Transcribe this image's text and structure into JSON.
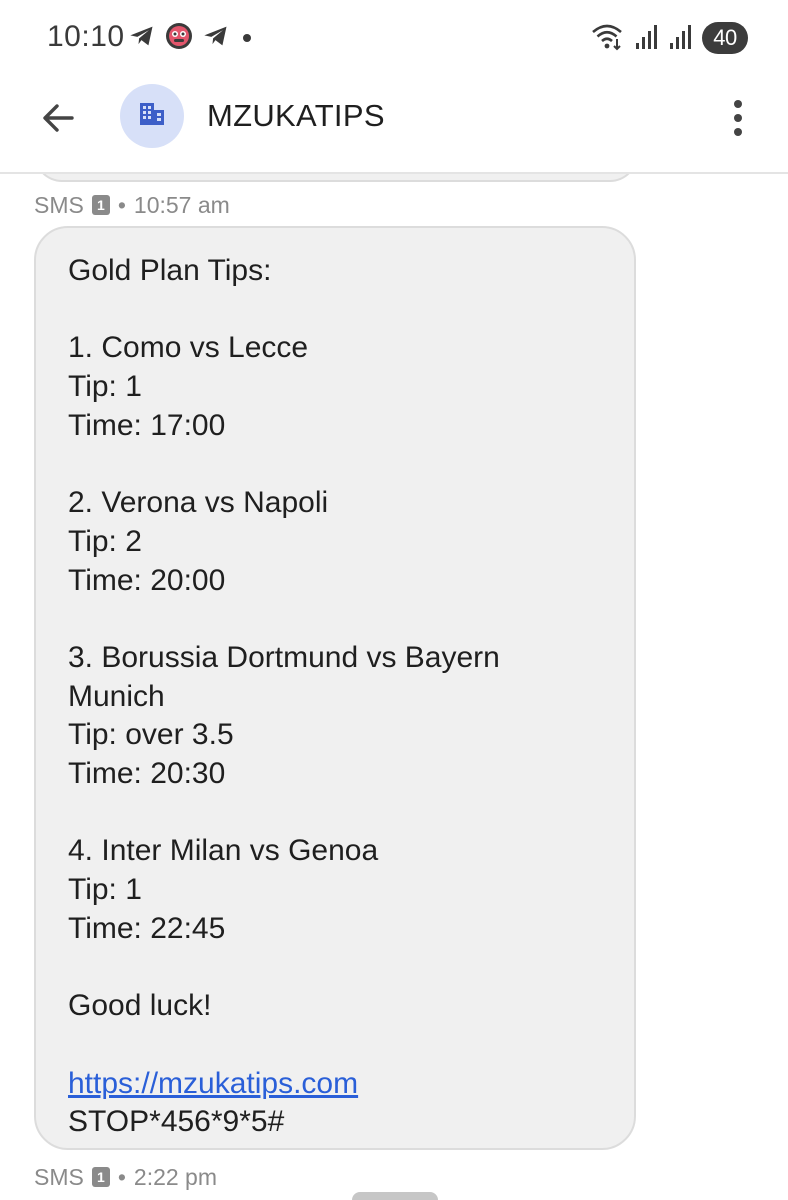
{
  "status_bar": {
    "time": "10:10",
    "battery_level": "40",
    "notification_icons": [
      "telegram-icon",
      "app-mask-icon",
      "telegram-icon",
      "dot-icon"
    ],
    "system_icons": [
      "wifi-calling-icon",
      "signal-icon",
      "signal-icon",
      "battery-icon"
    ]
  },
  "app_bar": {
    "back_icon": "arrow-back-icon",
    "avatar_icon": "business-building-icon",
    "title": "MZUKATIPS",
    "more_icon": "more-vert-icon"
  },
  "messages": [
    {
      "meta": {
        "channel": "SMS",
        "sim": "1",
        "separator": "•",
        "time": "10:57 am"
      },
      "lines": [
        "Gold Plan Tips:",
        "",
        "1. Como vs Lecce",
        "Tip: 1",
        "Time: 17:00",
        "",
        "2. Verona vs Napoli",
        "Tip: 2",
        "Time: 20:00",
        "",
        "3. Borussia Dortmund vs Bayern",
        "Munich",
        "Tip: over 3.5",
        "Time: 20:30",
        "",
        "4. Inter Milan vs Genoa",
        "Tip: 1",
        "Time: 22:45",
        "",
        "Good luck!",
        ""
      ],
      "link": "https://mzukatips.com",
      "footer": "STOP*456*9*5#"
    }
  ],
  "next_meta": {
    "channel": "SMS",
    "sim": "1",
    "separator": "•",
    "time": "2:22 pm"
  },
  "colors": {
    "bubble_bg": "#f0f0f0",
    "avatar_bg": "#d7e0f8",
    "avatar_icon": "#3d5fc8",
    "link": "#2a5fd8",
    "meta_text": "#8a8a8a"
  }
}
